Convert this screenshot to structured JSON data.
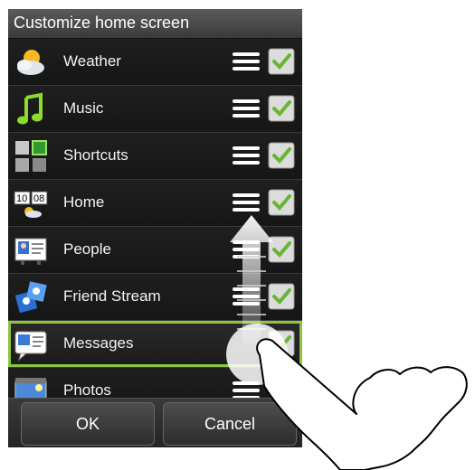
{
  "header": {
    "title": "Customize home screen"
  },
  "items": [
    {
      "label": "Weather",
      "icon": "weather-icon",
      "checked": true
    },
    {
      "label": "Music",
      "icon": "music-icon",
      "checked": true
    },
    {
      "label": "Shortcuts",
      "icon": "shortcuts-icon",
      "checked": true
    },
    {
      "label": "Home",
      "icon": "home-clock-icon",
      "checked": true
    },
    {
      "label": "People",
      "icon": "people-icon",
      "checked": true
    },
    {
      "label": "Friend Stream",
      "icon": "friend-stream-icon",
      "checked": true
    },
    {
      "label": "Messages",
      "icon": "messages-icon",
      "checked": true,
      "selected": true
    },
    {
      "label": "Photos",
      "icon": "photos-icon",
      "checked": true
    }
  ],
  "buttons": {
    "ok": "OK",
    "cancel": "Cancel"
  },
  "colors": {
    "accent": "#8cc63f",
    "check": "#7fd03a",
    "background": "#181818"
  }
}
